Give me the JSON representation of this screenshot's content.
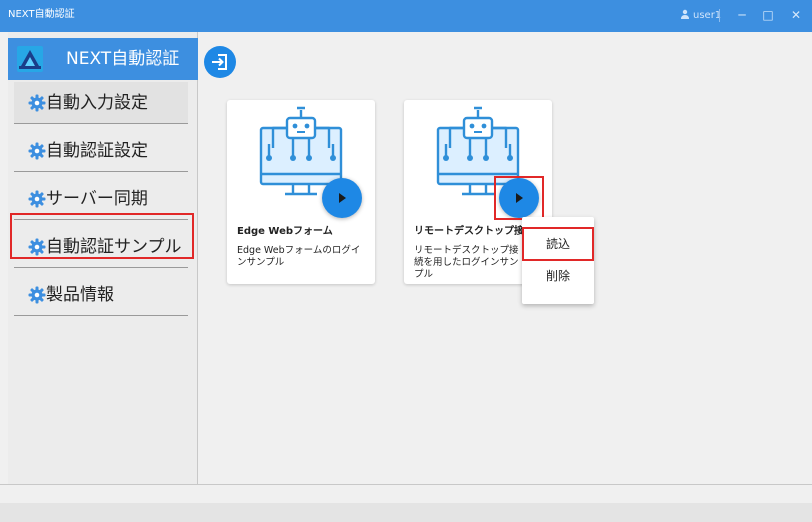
{
  "window": {
    "title": "NEXT自動認証",
    "user": "user1",
    "minimize_glyph": "─",
    "maximize_glyph": "□",
    "close_glyph": "✕"
  },
  "sidebar": {
    "brand": "NEXT自動認証",
    "items": [
      {
        "label": "自動入力設定",
        "icon": "gear-icon",
        "active": true
      },
      {
        "label": "自動認証設定",
        "icon": "gear-icon",
        "active": false
      },
      {
        "label": "サーバー同期",
        "icon": "gear-icon",
        "active": false
      },
      {
        "label": "自動認証サンプル",
        "icon": "gear-icon",
        "active": false,
        "highlighted": true
      },
      {
        "label": "製品情報",
        "icon": "gear-icon",
        "active": false
      }
    ]
  },
  "main": {
    "logout_icon": "logout-icon",
    "cards": [
      {
        "title": "Edge Webフォーム",
        "description": "Edge Webフォームのログインサンプル",
        "play_icon": "play-icon"
      },
      {
        "title": "リモートデスクトップ接続",
        "description": "リモートデスクトップ接続を用したログインサンプル",
        "play_icon": "play-icon",
        "play_highlighted": true
      }
    ],
    "context_menu": {
      "items": [
        "読込",
        "削除"
      ],
      "highlighted": "読込"
    }
  },
  "colors": {
    "accent": "#1e88e5",
    "titlebar": "#3d8fe0",
    "illustration": "#2f8fd8",
    "highlight": "#e12828",
    "gear": "#3d8fe0"
  }
}
